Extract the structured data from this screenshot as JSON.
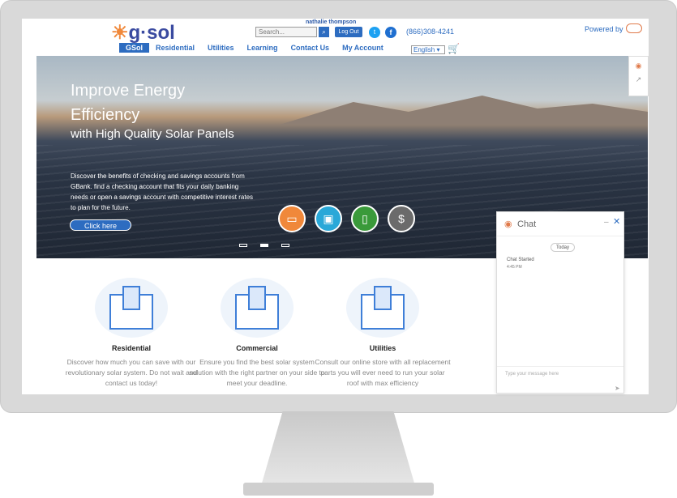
{
  "header": {
    "logo_text": "g·sol",
    "user_name": "nathalie thompson",
    "search_placeholder": "Search...",
    "search_icon": "search-icon",
    "logout_label": "Log Out",
    "phone": "(866)308-4241",
    "powered_by": "Powered by",
    "language": "English"
  },
  "nav": {
    "items": [
      "GSol",
      "Residential",
      "Utilities",
      "Learning",
      "Contact Us",
      "My Account"
    ]
  },
  "hero": {
    "title_line1": "Improve Energy",
    "title_line2": "Efficiency",
    "subtitle": "with High Quality Solar Panels",
    "blurb": "Discover the benefits of checking and savings accounts from GBank. find a checking account that fits your daily banking needs or open a savings account with competitive interest rates to plan for the future.",
    "cta_label": "Click here",
    "circle_icons": [
      "credit-card-icon",
      "wallet-icon",
      "mobile-icon",
      "laptop-dollar-icon"
    ]
  },
  "features": [
    {
      "title": "Residential",
      "desc": "Discover how much you can save with our revolutionary solar system. Do not wait and contact us today!"
    },
    {
      "title": "Commercial",
      "desc": "Ensure you find the best solar system solution with the right partner on your side to meet your deadline."
    },
    {
      "title": "Utilities",
      "desc": "Consult our online store with all replacement parts you will ever need to run your solar roof with max efficiency"
    }
  ],
  "chat": {
    "title": "Chat",
    "day_label": "Today",
    "status": "Chat Started",
    "time": "4:45 PM",
    "input_placeholder": "Type your message here"
  },
  "colors": {
    "accent": "#2d6cc0",
    "brand_orange": "#f0883a"
  }
}
